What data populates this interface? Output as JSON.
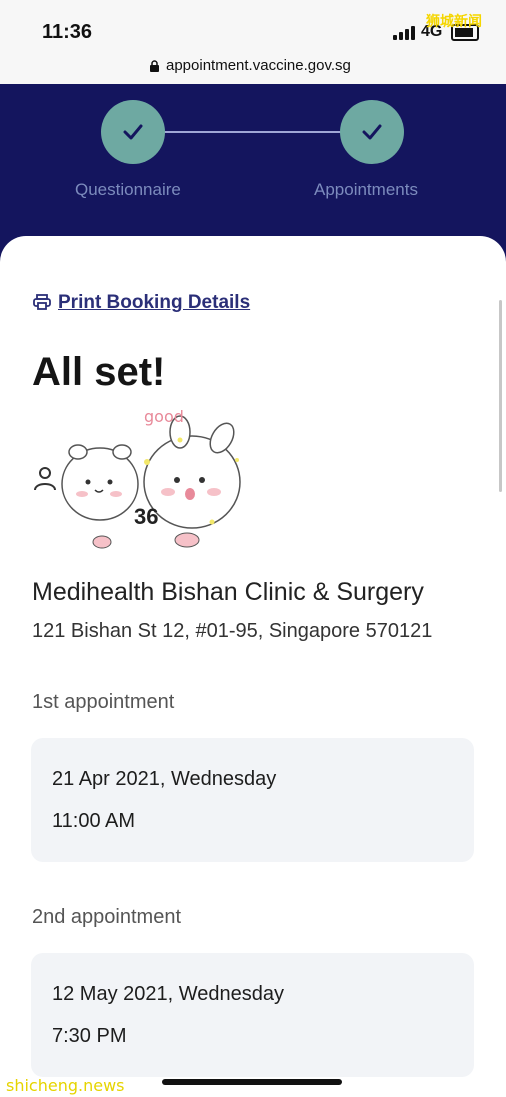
{
  "status_bar": {
    "time": "11:36",
    "network": "4G",
    "watermark": "狮城新闻"
  },
  "browser": {
    "url": "appointment.vaccine.gov.sg"
  },
  "progress": {
    "steps": [
      {
        "label": "Questionnaire",
        "state": "done"
      },
      {
        "label": "Appointments",
        "state": "done"
      }
    ]
  },
  "booking": {
    "print_link": "Print Booking Details",
    "title": "All set!",
    "sticker_text": "good",
    "partial_text": "36",
    "clinic_name": "Medihealth Bishan Clinic & Surgery",
    "clinic_address": "121 Bishan St 12, #01-95, Singapore 570121"
  },
  "appointments": [
    {
      "label": "1st appointment",
      "date": "21 Apr 2021, Wednesday",
      "time": "11:00 AM"
    },
    {
      "label": "2nd appointment",
      "date": "12 May 2021, Wednesday",
      "time": "7:30 PM"
    }
  ],
  "footer": {
    "watermark": "shicheng.news"
  },
  "colors": {
    "header_navy": "#14155e",
    "step_teal": "#6ea9a2",
    "link": "#2b2f78",
    "appointment_card": "#f2f4f7"
  }
}
